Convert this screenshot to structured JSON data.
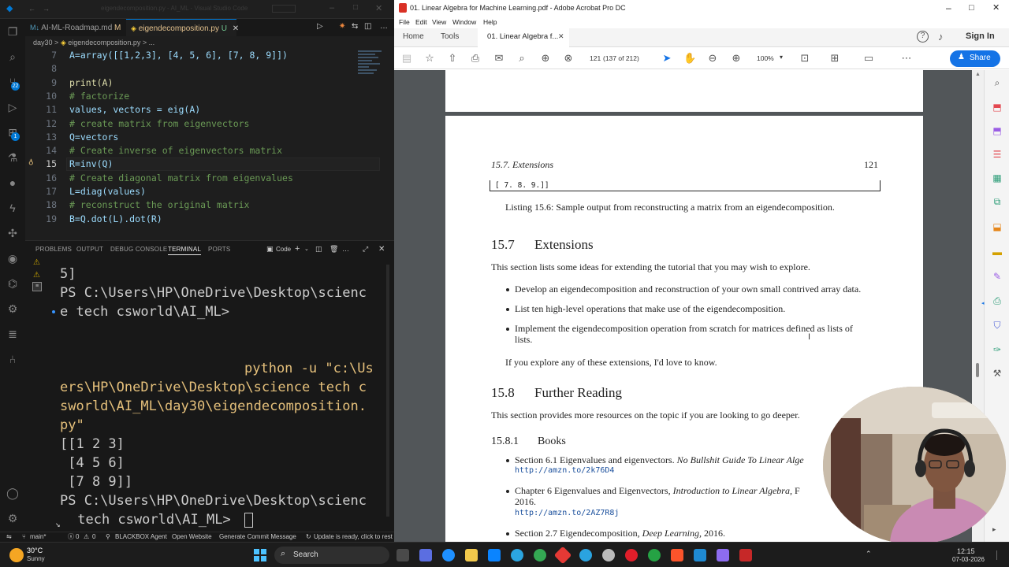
{
  "vscode": {
    "title": "eigendecomposition.py - AI_ML - Visual Studio Code",
    "tabs": [
      {
        "label": "AI-ML-Roadmap.md",
        "badge": "M"
      },
      {
        "label": "eigendecomposition.py",
        "badge": "U"
      }
    ],
    "breadcrumb": {
      "folder": "day30",
      "sep": ">",
      "file": "eigendecomposition.py",
      "more": "> ..."
    },
    "activity_badges": [
      "22",
      "1"
    ],
    "code_lines": [
      {
        "num": "7",
        "text": "A=array([[1,2,3], [4, 5, 6], [7, 8, 9]])"
      },
      {
        "num": "8",
        "text": ""
      },
      {
        "num": "9",
        "text": "print(A)"
      },
      {
        "num": "10",
        "text": "# factorize"
      },
      {
        "num": "11",
        "text": "values, vectors = eig(A)"
      },
      {
        "num": "12",
        "text": "# create matrix from eigenvectors"
      },
      {
        "num": "13",
        "text": "Q=vectors"
      },
      {
        "num": "14",
        "text": "# Create inverse of eigenvectors matrix"
      },
      {
        "num": "15",
        "text": "R=inv(Q)"
      },
      {
        "num": "16",
        "text": "# Create diagonal matrix from eigenvalues"
      },
      {
        "num": "17",
        "text": "L=diag(values)"
      },
      {
        "num": "18",
        "text": "# reconstruct the original matrix"
      },
      {
        "num": "19",
        "text": "B=Q.dot(L).dot(R)"
      }
    ],
    "panel_tabs": [
      "PROBLEMS",
      "OUTPUT",
      "DEBUG CONSOLE",
      "TERMINAL",
      "PORTS"
    ],
    "panel_profile": "Code",
    "terminal_lines": [
      "5]",
      "PS C:\\Users\\HP\\OneDrive\\Desktop\\scienc",
      "e tech csworld\\AI_ML>",
      "",
      "",
      "python -u \"c:\\Us",
      "ers\\HP\\OneDrive\\Desktop\\science tech c",
      "sworld\\AI_ML\\day30\\eigendecomposition.",
      "py\"",
      "[[1 2 3]",
      " [4 5 6]",
      " [7 8 9]]",
      "PS C:\\Users\\HP\\OneDrive\\Desktop\\scienc",
      " tech csworld\\AI_ML>"
    ],
    "status": {
      "branch": "main*",
      "errors": "0",
      "warnings": "0",
      "blackbox": "BLACKBOX Agent",
      "open_website": "Open Website",
      "commit": "Generate Commit Message",
      "ready": "Update is ready, click to rest"
    }
  },
  "acrobat": {
    "title": "01. Linear Algebra for Machine Learning.pdf - Adobe Acrobat Pro DC",
    "menu": [
      "File",
      "Edit",
      "View",
      "Window",
      "Help"
    ],
    "nav": {
      "home": "Home",
      "tools": "Tools",
      "doc_tab": "01. Linear Algebra f...",
      "sign_in": "Sign In"
    },
    "toolbar": {
      "page": "121",
      "page_info": "(137 of 212)",
      "zoom": "100%",
      "share": "Share"
    },
    "page": {
      "header_left": "15.7. Extensions",
      "header_right": "121",
      "listing_code": "[ 7.  8.  9.]]",
      "listing_caption": "Listing 15.6: Sample output from reconstructing a matrix from an eigendecomposition.",
      "sec_num": "15.7",
      "sec_title": "Extensions",
      "intro": "This section lists some ideas for extending the tutorial that you may wish to explore.",
      "bullets": [
        "Develop an eigendecomposition and reconstruction of your own small contrived array data.",
        "List ten high-level operations that make use of the eigendecomposition.",
        "Implement the eigendecomposition operation from scratch for matrices defined as lists of",
        "lists."
      ],
      "outro": "If you explore any of these extensions, I'd love to know.",
      "sec2_num": "15.8",
      "sec2_title": "Further Reading",
      "sec2_intro": "This section provides more resources on the topic if you are looking to go deeper.",
      "sub_num": "15.8.1",
      "sub_title": "Books",
      "books": [
        {
          "text": "Section 6.1 Eigenvalues and eigenvectors.",
          "italic": "No Bullshit Guide To Linear Alge",
          "link": "http://amzn.to/2k76D4"
        },
        {
          "text": "Chapter 6 Eigenvalues and Eigenvectors,",
          "italic": "Introduction to Linear Algebra,",
          "tail": "F",
          "line2": "2016.",
          "link": "http://amzn.to/2AZ7R8j"
        },
        {
          "text": "Section 2.7 Eigendecomposition,",
          "italic": "Deep Learning,",
          "tail": "2016."
        }
      ]
    }
  },
  "taskbar": {
    "weather_temp": "30°C",
    "weather_desc": "Sunny",
    "search": "Search",
    "time": "12:15",
    "date": "07-03-2026"
  },
  "colors": {
    "vscode_bg": "#1e1e1e",
    "accent": "#0078d4",
    "acrobat_share": "#1473e6",
    "terminal_yellow": "#e5c07b"
  }
}
